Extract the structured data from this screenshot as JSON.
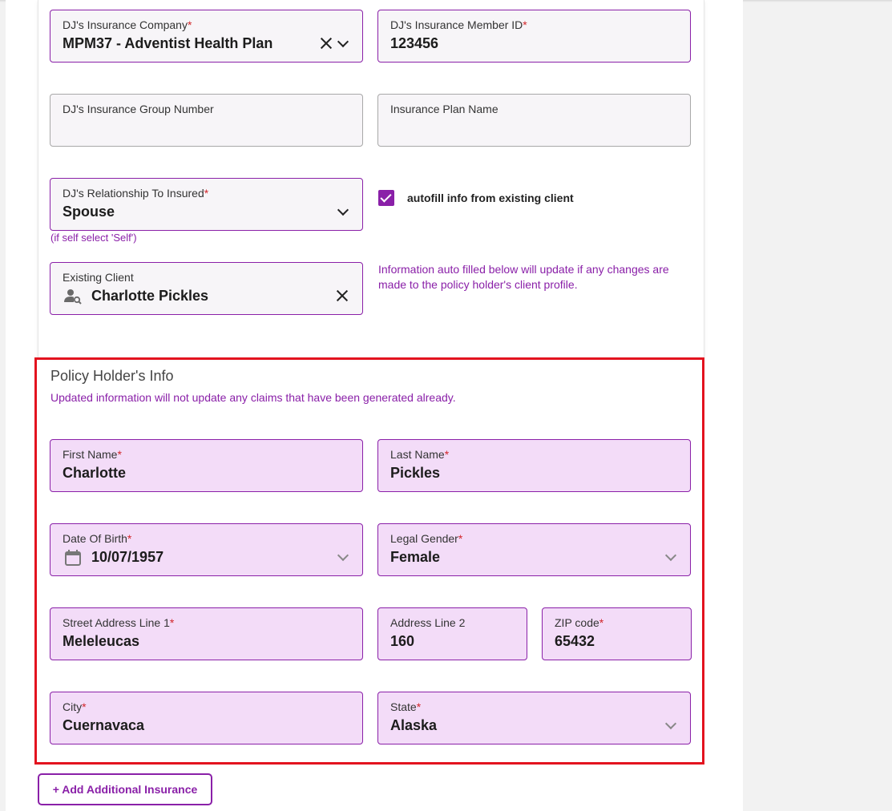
{
  "insurance": {
    "company": {
      "label": "DJ's Insurance Company",
      "required": "*",
      "value": "MPM37 -  Adventist Health Plan"
    },
    "member_id": {
      "label": "DJ's Insurance Member ID",
      "required": "*",
      "value": "123456"
    },
    "group_number": {
      "label": "DJ's Insurance Group Number",
      "value": ""
    },
    "plan_name": {
      "label": "Insurance Plan Name",
      "value": ""
    },
    "relationship": {
      "label": "DJ's Relationship To Insured",
      "required": "*",
      "value": "Spouse",
      "hint": "(if self select 'Self')"
    },
    "autofill": {
      "checked": true,
      "label": "autofill info from existing client"
    },
    "existing_client": {
      "label": "Existing Client",
      "value": "Charlotte Pickles",
      "icon": "person-search-icon"
    },
    "autofill_info": "Information auto filled below will update if any changes are made to the policy holder's client profile."
  },
  "policy_holder": {
    "title": "Policy Holder's Info",
    "note": "Updated information will not update any claims that have been generated already.",
    "first_name": {
      "label": "First Name",
      "required": "*",
      "value": "Charlotte"
    },
    "last_name": {
      "label": "Last Name",
      "required": "*",
      "value": "Pickles"
    },
    "dob": {
      "label": "Date Of Birth",
      "required": "*",
      "value": "10/07/1957",
      "icon": "calendar-icon"
    },
    "gender": {
      "label": "Legal Gender",
      "required": "*",
      "value": "Female"
    },
    "street1": {
      "label": "Street Address Line 1",
      "required": "*",
      "value": "Meleleucas"
    },
    "address2": {
      "label": "Address Line 2",
      "value": "160"
    },
    "zip": {
      "label": "ZIP code",
      "required": "*",
      "value": "65432"
    },
    "city": {
      "label": "City",
      "required": "*",
      "value": "Cuernavaca"
    },
    "state": {
      "label": "State",
      "required": "*",
      "value": "Alaska"
    }
  },
  "add_insurance_label": "+ Add Additional Insurance",
  "colors": {
    "accent": "#8a20a8",
    "highlight_border": "#e3131f",
    "filled_bg": "#f3dcf8",
    "required": "#d2262a"
  }
}
